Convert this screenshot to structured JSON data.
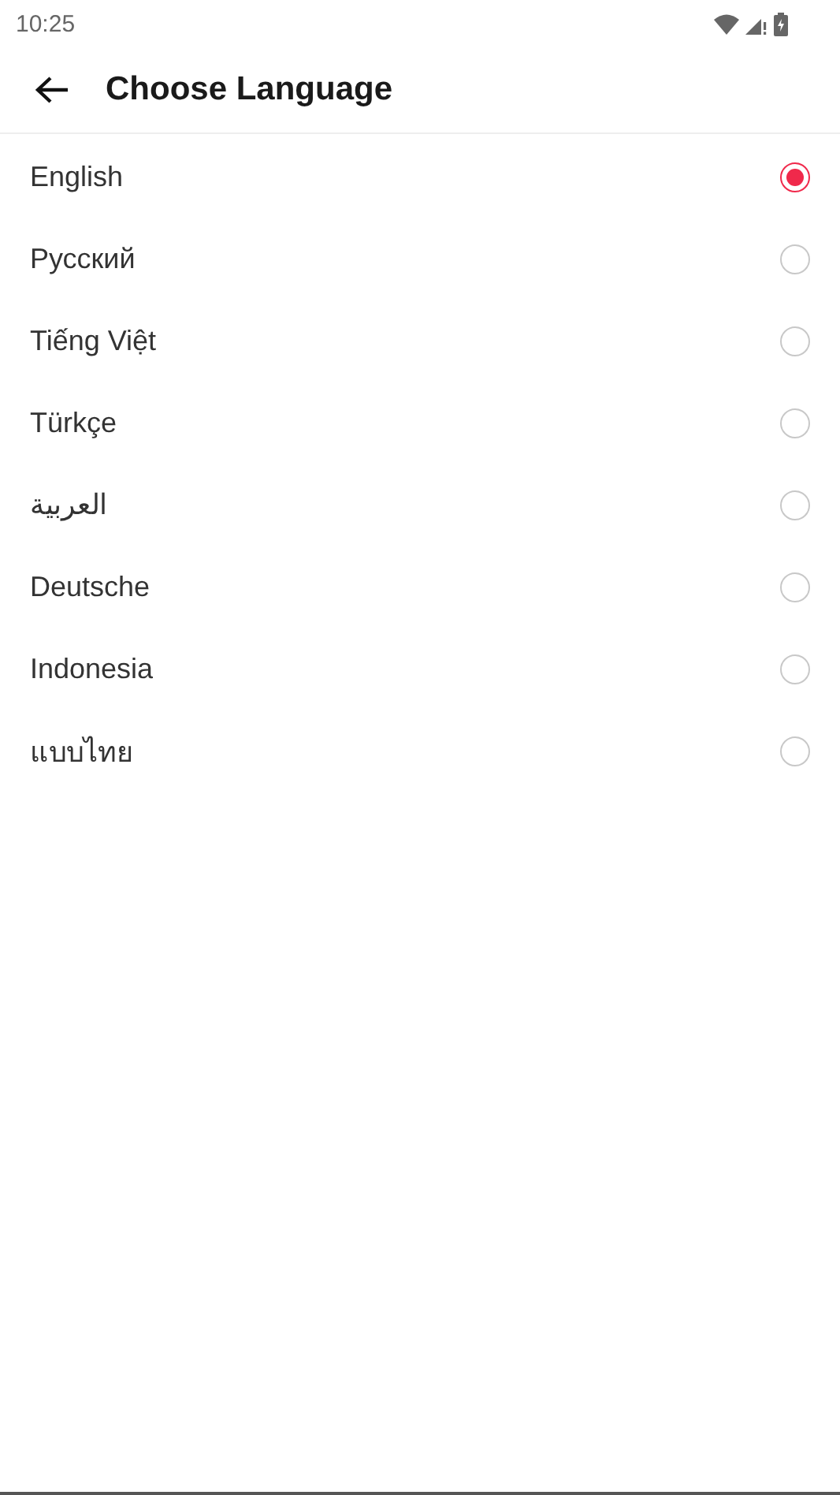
{
  "status_bar": {
    "time": "10:25"
  },
  "header": {
    "title": "Choose Language"
  },
  "languages": [
    {
      "label": "English",
      "selected": true
    },
    {
      "label": "Русский",
      "selected": false
    },
    {
      "label": "Tiếng Việt",
      "selected": false
    },
    {
      "label": "Türkçe",
      "selected": false
    },
    {
      "label": "العربية",
      "selected": false
    },
    {
      "label": "Deutsche",
      "selected": false
    },
    {
      "label": "Indonesia",
      "selected": false
    },
    {
      "label": "แบบไทย",
      "selected": false
    }
  ]
}
